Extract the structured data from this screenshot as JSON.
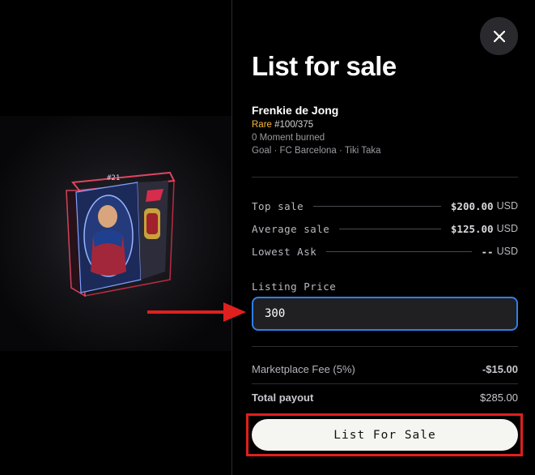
{
  "panel": {
    "title": "List for sale",
    "close_icon": "close-icon"
  },
  "moment": {
    "player_name": "Frenkie de Jong",
    "rarity": "Rare",
    "serial": "#100/375",
    "burned": "0 Moment burned",
    "details": "Goal · FC Barcelona · Tiki Taka",
    "card_number": "#21"
  },
  "stats": [
    {
      "label": "Top sale",
      "value": "$200.00",
      "unit": "USD"
    },
    {
      "label": "Average sale",
      "value": "$125.00",
      "unit": "USD"
    },
    {
      "label": "Lowest Ask",
      "value": "--",
      "unit": "USD"
    }
  ],
  "listing": {
    "label": "Listing Price",
    "value": "300"
  },
  "fees": {
    "marketplace_label": "Marketplace Fee (5%)",
    "marketplace_value": "-$15.00",
    "total_label": "Total payout",
    "total_value": "$285.00"
  },
  "action": {
    "button_label": "List For Sale"
  },
  "colors": {
    "rarity": "#f4b942",
    "input_focus": "#2f7fe8",
    "annotation": "#e01f1f"
  }
}
